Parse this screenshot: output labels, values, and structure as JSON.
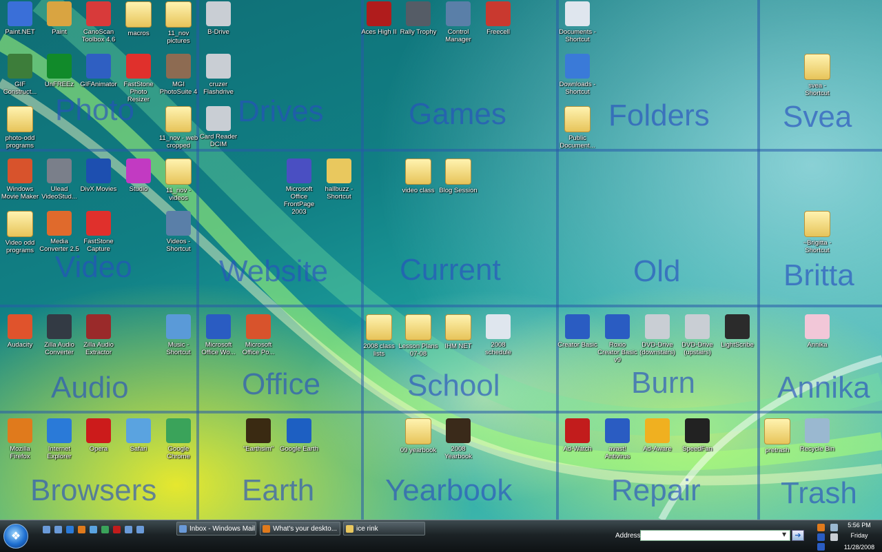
{
  "desktop": {
    "zones": [
      "Photo",
      "Drives",
      "Games",
      "Folders",
      "Svea",
      "Video",
      "Website",
      "Current",
      "Old",
      "Britta",
      "Audio",
      "Office",
      "School",
      "Burn",
      "Annika",
      "Browsers",
      "Earth",
      "Yearbook",
      "Repair",
      "Trash"
    ],
    "icons": [
      {
        "label": "Paint.NET",
        "icon": "paintnet-icon",
        "color": "#3a6fd8"
      },
      {
        "label": "Paint",
        "icon": "paint-icon",
        "color": "#d9a441"
      },
      {
        "label": "CanoScan Toolbox 4.6",
        "icon": "canoscan-icon",
        "color": "#d83a3a"
      },
      {
        "label": "macros",
        "icon": "folder-icon",
        "color": "#e9c85e"
      },
      {
        "label": "11_nov pictures",
        "icon": "folder-icon",
        "color": "#e9c85e"
      },
      {
        "label": "B-Drive",
        "icon": "drive-icon",
        "color": "#c9ced4"
      },
      {
        "label": "Aces High II",
        "icon": "aceshigh-icon",
        "color": "#b01c1c"
      },
      {
        "label": "Rally Trophy",
        "icon": "steering-wheel-icon",
        "color": "#555c66"
      },
      {
        "label": "Control Manager",
        "icon": "monitor-icon",
        "color": "#5a7fa8"
      },
      {
        "label": "Freecell",
        "icon": "cards-icon",
        "color": "#c9392f"
      },
      {
        "label": "Documents - Shortcut",
        "icon": "document-icon",
        "color": "#dfe6ee"
      },
      {
        "label": "GIF Construct...",
        "icon": "gif-constructor-icon",
        "color": "#3d7d3a"
      },
      {
        "label": "UnFREEz",
        "icon": "unfreez-icon",
        "color": "#118a2a"
      },
      {
        "label": "GIFAnimator",
        "icon": "gifanimator-icon",
        "color": "#2f5fc2"
      },
      {
        "label": "FastStone Photo Resizer",
        "icon": "faststone-resizer-icon",
        "color": "#e0302c"
      },
      {
        "label": "MGI PhotoSuite 4",
        "icon": "photosuite-icon",
        "color": "#8d6b52"
      },
      {
        "label": "cruzer Flashdrive",
        "icon": "usb-drive-icon",
        "color": "#c9ced4"
      },
      {
        "label": "Downloads - Shortcut",
        "icon": "downloads-icon",
        "color": "#3a7ad8"
      },
      {
        "label": "svea - Shortcut",
        "icon": "folder-icon",
        "color": "#e9c85e"
      },
      {
        "label": "photo-odd programs",
        "icon": "folder-icon",
        "color": "#e9c85e"
      },
      {
        "label": "11_nov - web cropped",
        "icon": "folder-icon",
        "color": "#e9c85e"
      },
      {
        "label": "Card Reader DCIM",
        "icon": "card-reader-icon",
        "color": "#c9ced4"
      },
      {
        "label": "Public Document...",
        "icon": "folder-icon",
        "color": "#e9c85e"
      },
      {
        "label": "Windows Movie Maker",
        "icon": "moviemaker-icon",
        "color": "#d8532c"
      },
      {
        "label": "Ulead VideoStud...",
        "icon": "ulead-icon",
        "color": "#7a7f8a"
      },
      {
        "label": "DivX Movies",
        "icon": "divx-icon",
        "color": "#1d4fb0"
      },
      {
        "label": "Studio",
        "icon": "studio-icon",
        "color": "#c23ac2"
      },
      {
        "label": "11_nov - videos",
        "icon": "folder-icon",
        "color": "#e9c85e"
      },
      {
        "label": "Microsoft Office FrontPage 2003",
        "icon": "frontpage-icon",
        "color": "#4a4fc2"
      },
      {
        "label": "hallbuzz - Shortcut",
        "icon": "folder-globe-icon",
        "color": "#e9c85e"
      },
      {
        "label": "video class",
        "icon": "folder-icon",
        "color": "#e9c85e"
      },
      {
        "label": "Blog Session",
        "icon": "folder-icon",
        "color": "#e9c85e"
      },
      {
        "label": "Video odd programs",
        "icon": "folder-icon",
        "color": "#e9c85e"
      },
      {
        "label": "Media Converter 2.5",
        "icon": "media-converter-icon",
        "color": "#e06a2c"
      },
      {
        "label": "FastStone Capture",
        "icon": "faststone-capture-icon",
        "color": "#e0302c"
      },
      {
        "label": "Videos - Shortcut",
        "icon": "videos-icon",
        "color": "#5a7fa8"
      },
      {
        "label": "~Brigitta - Shortcut",
        "icon": "folder-icon",
        "color": "#e9c85e"
      },
      {
        "label": "Audacity",
        "icon": "audacity-icon",
        "color": "#e0532c"
      },
      {
        "label": "Zilla Audio Converter",
        "icon": "zilla-converter-icon",
        "color": "#333a44"
      },
      {
        "label": "Zilla Audio Extractor",
        "icon": "zilla-extractor-icon",
        "color": "#9a2a2a"
      },
      {
        "label": "Music - Shortcut",
        "icon": "music-icon",
        "color": "#5a9ad8"
      },
      {
        "label": "Microsoft Office Wo...",
        "icon": "word-icon",
        "color": "#2a5cc2"
      },
      {
        "label": "Microsoft Office Po...",
        "icon": "powerpoint-icon",
        "color": "#d8532c"
      },
      {
        "label": "2008 class lists",
        "icon": "folder-icon",
        "color": "#e9c85e"
      },
      {
        "label": "Lesson Plans 07-08",
        "icon": "folder-icon",
        "color": "#e9c85e"
      },
      {
        "label": "IHM NET",
        "icon": "folder-icon",
        "color": "#e9c85e"
      },
      {
        "label": "2008 schedule",
        "icon": "word-document-icon",
        "color": "#dfe6ee"
      },
      {
        "label": "Creator Basic",
        "icon": "creator-icon",
        "color": "#2a5cc2"
      },
      {
        "label": "Roxio Creator Basic v9",
        "icon": "roxio-icon",
        "color": "#2a5cc2"
      },
      {
        "label": "DVD-Drive (downstairs)",
        "icon": "dvd-drive-icon",
        "color": "#c9ced4"
      },
      {
        "label": "DVD-Drive (upstairs)",
        "icon": "dvd-drive-icon",
        "color": "#c9ced4"
      },
      {
        "label": "LightScribe",
        "icon": "lightscribe-icon",
        "color": "#2b2b2b"
      },
      {
        "label": "Annika",
        "icon": "annika-icon",
        "color": "#f2c7d8"
      },
      {
        "label": "Mozilla Firefox",
        "icon": "firefox-icon",
        "color": "#e07a1c"
      },
      {
        "label": "Internet Explorer",
        "icon": "ie-icon",
        "color": "#2a7ad8"
      },
      {
        "label": "Opera",
        "icon": "opera-icon",
        "color": "#cc1b1b"
      },
      {
        "label": "Safari",
        "icon": "safari-icon",
        "color": "#5aa3e0"
      },
      {
        "label": "Google Chrome",
        "icon": "chrome-icon",
        "color": "#3aa35a"
      },
      {
        "label": "\"Earthsim\"",
        "icon": "earthsim-icon",
        "color": "#3a2a12"
      },
      {
        "label": "Google Earth",
        "icon": "google-earth-icon",
        "color": "#1d5fc2"
      },
      {
        "label": "09 yearbook",
        "icon": "folder-icon",
        "color": "#e9c85e"
      },
      {
        "label": "2008 Yearbook",
        "icon": "yearbook-icon",
        "color": "#3a2a1a"
      },
      {
        "label": "Ad-Watch",
        "icon": "adwatch-icon",
        "color": "#c21c1c"
      },
      {
        "label": "avast! Antivirus",
        "icon": "avast-icon",
        "color": "#2a5cc2"
      },
      {
        "label": "Ad-Aware",
        "icon": "adaware-icon",
        "color": "#f0b020"
      },
      {
        "label": "SpeedFan",
        "icon": "speedfan-icon",
        "color": "#222222"
      },
      {
        "label": "pretrash",
        "icon": "folder-icon",
        "color": "#e9c85e"
      },
      {
        "label": "Recycle Bin",
        "icon": "recycle-bin-icon",
        "color": "#9ab8d0"
      }
    ]
  },
  "taskbar": {
    "quick_launch": [
      {
        "icon": "show-desktop-icon",
        "color": "#6a9ad8"
      },
      {
        "icon": "switch-windows-icon",
        "color": "#6a9ad8"
      },
      {
        "icon": "ie-icon",
        "color": "#2a7ad8"
      },
      {
        "icon": "firefox-icon",
        "color": "#e07a1c"
      },
      {
        "icon": "globe-icon",
        "color": "#5aa3e0"
      },
      {
        "icon": "chrome-icon",
        "color": "#3aa35a"
      },
      {
        "icon": "acrobat-icon",
        "color": "#c21c1c"
      },
      {
        "icon": "help-icon",
        "color": "#6a9ad8"
      },
      {
        "icon": "calendar-icon",
        "color": "#6a9ad8"
      }
    ],
    "windows": [
      {
        "label": "Inbox - Windows Mail",
        "icon": "mail-icon",
        "color": "#6a9ad8"
      },
      {
        "label": "What's your deskto...",
        "icon": "firefox-icon",
        "color": "#e07a1c"
      },
      {
        "label": "ice rink",
        "icon": "folder-icon",
        "color": "#e9c85e"
      }
    ],
    "address": {
      "label": "Address",
      "value": "",
      "placeholder": ""
    },
    "tray": [
      {
        "icon": "speedfan-tray-icon",
        "color": "#e07a1c"
      },
      {
        "icon": "network-icon",
        "color": "#9ab8d0"
      },
      {
        "icon": "avast-tray-icon",
        "color": "#2a5cc2"
      },
      {
        "icon": "volume-icon",
        "color": "#c9ced4"
      },
      {
        "icon": "bluetooth-icon",
        "color": "#2a5cc2"
      }
    ],
    "clock": {
      "time": "5:56 PM",
      "day": "Friday",
      "date": "11/28/2008"
    }
  }
}
